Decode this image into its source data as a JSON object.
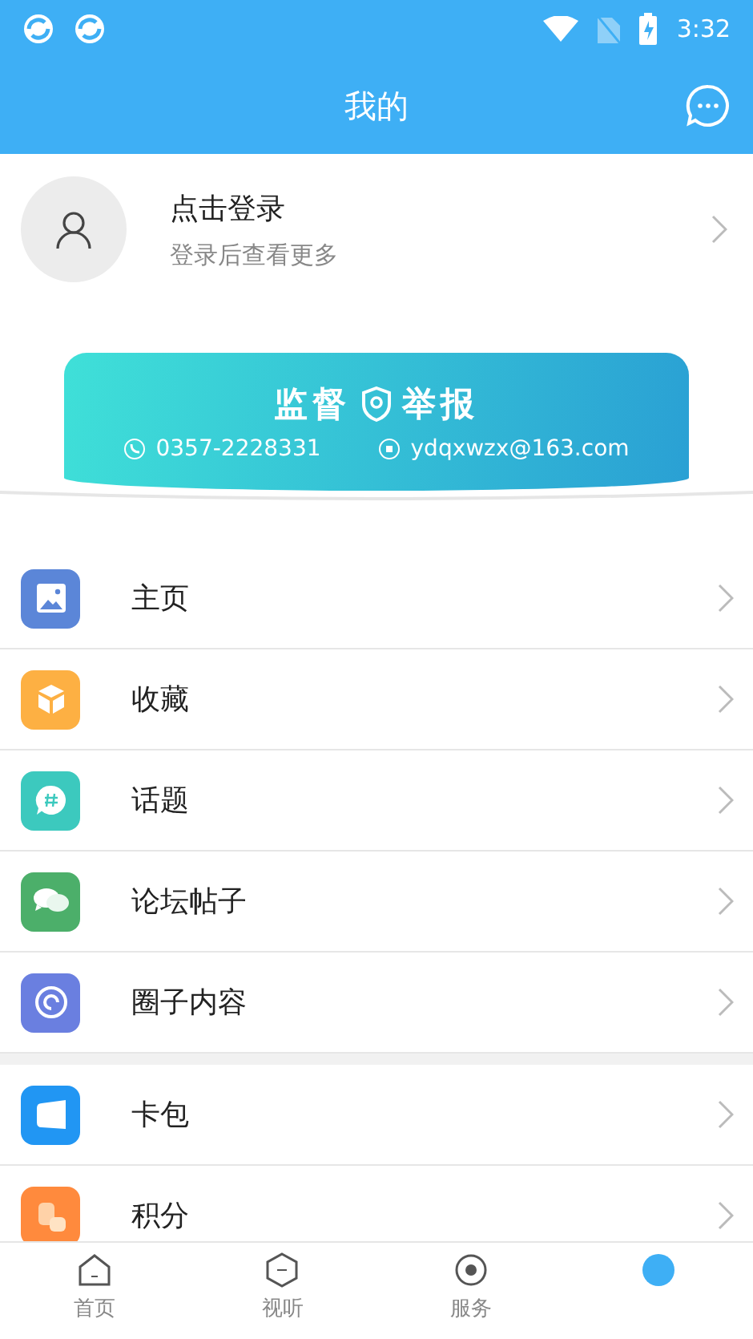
{
  "status_bar": {
    "time": "3:32"
  },
  "header": {
    "title": "我的"
  },
  "profile": {
    "name": "点击登录",
    "subtitle": "登录后查看更多"
  },
  "banner": {
    "title_left": "监督",
    "title_right": "举报",
    "phone": "0357-2228331",
    "email": "ydqxwzx@163.com"
  },
  "menu_groups": [
    [
      {
        "label": "主页",
        "kind": "image",
        "color": "#5b86d8"
      },
      {
        "label": "收藏",
        "kind": "box",
        "color": "#fdb043"
      },
      {
        "label": "话题",
        "kind": "topic",
        "color": "#3cc9be"
      },
      {
        "label": "论坛帖子",
        "kind": "chat",
        "color": "#4caf6a"
      },
      {
        "label": "圈子内容",
        "kind": "circle",
        "color": "#6a7fe0"
      }
    ],
    [
      {
        "label": "卡包",
        "kind": "card",
        "color": "#2196f3"
      },
      {
        "label": "积分",
        "kind": "coins",
        "color": "#ff8a3d"
      }
    ]
  ],
  "tabs": [
    {
      "label": "首页",
      "kind": "home",
      "selected": false
    },
    {
      "label": "视听",
      "kind": "media",
      "selected": false
    },
    {
      "label": "服务",
      "kind": "service",
      "selected": false
    },
    {
      "kind": "mine",
      "selected": true
    }
  ]
}
